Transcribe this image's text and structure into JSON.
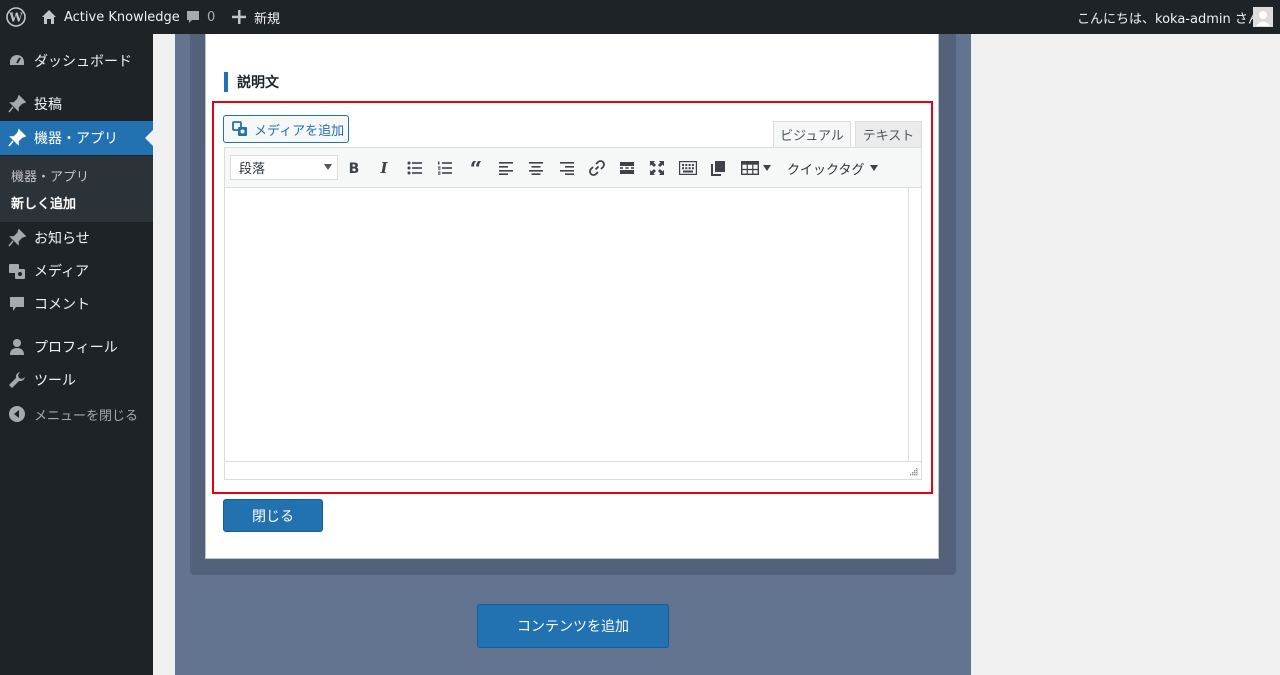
{
  "adminbar": {
    "site_name": "Active Knowledge",
    "comments_count": "0",
    "new_label": "新規",
    "greeting": "こんにちは、koka-admin さん"
  },
  "sidebar": {
    "items": [
      {
        "label": "ダッシュボード",
        "icon": "dashboard-icon"
      },
      {
        "label": "投稿",
        "icon": "pin-icon"
      },
      {
        "label": "機器・アプリ",
        "icon": "pin-icon"
      },
      {
        "label": "お知らせ",
        "icon": "pin-icon"
      },
      {
        "label": "メディア",
        "icon": "media-icon"
      },
      {
        "label": "コメント",
        "icon": "comment-icon"
      },
      {
        "label": "プロフィール",
        "icon": "user-icon"
      },
      {
        "label": "ツール",
        "icon": "wrench-icon"
      },
      {
        "label": "メニューを閉じる",
        "icon": "collapse-icon"
      }
    ],
    "submenu": [
      {
        "label": "機器・アプリ"
      },
      {
        "label": "新しく追加"
      }
    ]
  },
  "section": {
    "title": "説明文"
  },
  "editor": {
    "media_button": "メディアを追加",
    "tabs": [
      {
        "label": "ビジュアル"
      },
      {
        "label": "テキスト"
      }
    ],
    "format_select": "段落",
    "quicktags": "クイックタグ"
  },
  "buttons": {
    "close": "閉じる",
    "add_content": "コンテンツを追加"
  },
  "colors": {
    "admin_bg": "#1d2327",
    "accent": "#2271b1",
    "highlight_border": "#e60012",
    "main_bg": "#627490"
  }
}
